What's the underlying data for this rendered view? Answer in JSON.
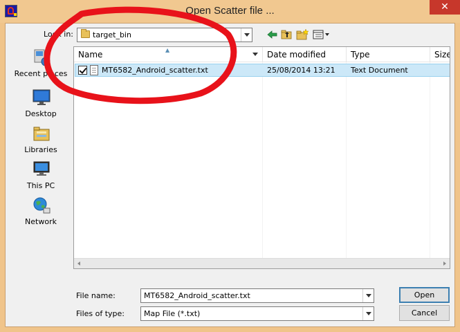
{
  "window": {
    "title": "Open Scatter file ...",
    "close_glyph": "✕"
  },
  "toolbar": {
    "look_in_label": "Look in:",
    "look_in_value": "target_bin",
    "icons": [
      "back-arrow-icon",
      "up-folder-icon",
      "new-folder-icon",
      "view-menu-icon"
    ]
  },
  "places": [
    {
      "label": "Recent places",
      "icon": "recent-places-icon"
    },
    {
      "label": "Desktop",
      "icon": "desktop-icon"
    },
    {
      "label": "Libraries",
      "icon": "libraries-icon"
    },
    {
      "label": "This PC",
      "icon": "this-pc-icon"
    },
    {
      "label": "Network",
      "icon": "network-icon"
    }
  ],
  "file_list": {
    "columns": [
      {
        "label": "Name"
      },
      {
        "label": "Date modified"
      },
      {
        "label": "Type"
      },
      {
        "label": "Size"
      }
    ],
    "rows": [
      {
        "checked": true,
        "name": "MT6582_Android_scatter.txt",
        "date_modified": "25/08/2014 13:21",
        "type": "Text Document",
        "size": ""
      }
    ]
  },
  "form": {
    "file_name_label": "File name:",
    "file_name_value": "MT6582_Android_scatter.txt",
    "files_of_type_label": "Files of type:",
    "files_of_type_value": "Map File (*.txt)",
    "open_label": "Open",
    "cancel_label": "Cancel"
  },
  "colors": {
    "title_bar": "#f1c890",
    "close_button": "#c7372b",
    "selection": "#cce8f8",
    "annotation": "#e8121a"
  }
}
